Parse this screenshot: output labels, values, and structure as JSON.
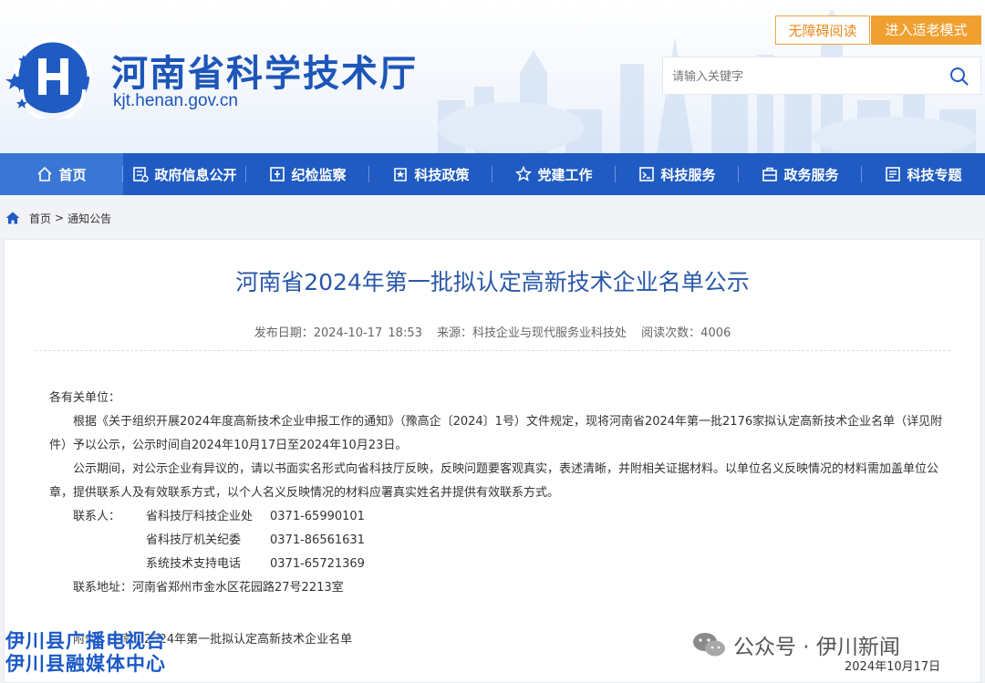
{
  "header": {
    "site_title": "河南省科学技术厅",
    "site_domain": "kjt.henan.gov.cn",
    "btn_access": "无障碍阅读",
    "btn_elder": "进入适老模式",
    "search_placeholder": "请输入关键字",
    "brand_color": "#1f5bc2",
    "accent_color": "#f0a030"
  },
  "nav": {
    "items": [
      {
        "label": "首页",
        "icon": "home-icon"
      },
      {
        "label": "政府信息公开",
        "icon": "info-icon"
      },
      {
        "label": "纪检监察",
        "icon": "inspect-icon"
      },
      {
        "label": "科技政策",
        "icon": "policy-icon"
      },
      {
        "label": "党建工作",
        "icon": "star-icon"
      },
      {
        "label": "科技服务",
        "icon": "service-icon"
      },
      {
        "label": "政务服务",
        "icon": "briefcase-icon"
      },
      {
        "label": "科技专题",
        "icon": "topic-icon"
      }
    ]
  },
  "breadcrumb": {
    "home": "首页",
    "sep": ">",
    "current": "通知公告"
  },
  "article": {
    "title": "河南省2024年第一批拟认定高新技术企业名单公示",
    "meta_date": "发布日期：2024-10-17 18:53",
    "meta_source": "来源：科技企业与现代服务业科技处",
    "meta_views": "阅读次数：4006",
    "greeting": "各有关单位：",
    "para1": "根据《关于组织开展2024年度高新技术企业申报工作的通知》（豫高企〔2024〕1号）文件规定，现将河南省2024年第一批2176家拟认定高新技术企业名单（详见附件）予以公示，公示时间自2024年10月17日至2024年10月23日。",
    "para2": "公示期间，对公示企业有异议的，请以书面实名形式向省科技厅反映，反映问题要客观真实，表述清晰，并附相关证据材料。以单位名义反映情况的材料需加盖单位公章，提供联系人及有效联系方式，以个人名义反映情况的材料应署真实姓名并提供有效联系方式。",
    "contact_label": "联系人：",
    "contacts": [
      {
        "name": "省科技厅科技企业处",
        "phone": "0371-65990101"
      },
      {
        "name": "省科技厅机关纪委",
        "phone": "0371-86561631"
      },
      {
        "name": "系统技术支持电话",
        "phone": "0371-65721369"
      }
    ],
    "address": "联系地址：河南省郑州市金水区花园路27号2213室",
    "attachment": "附件：河南省2024年第一批拟认定高新技术企业名单"
  },
  "overlay": {
    "wm_line1": "伊川县广播电视台",
    "wm_line2": "伊川县融媒体中心",
    "wechat_text": "公众号 · 伊川新闻",
    "date": "2024年10月17日"
  }
}
